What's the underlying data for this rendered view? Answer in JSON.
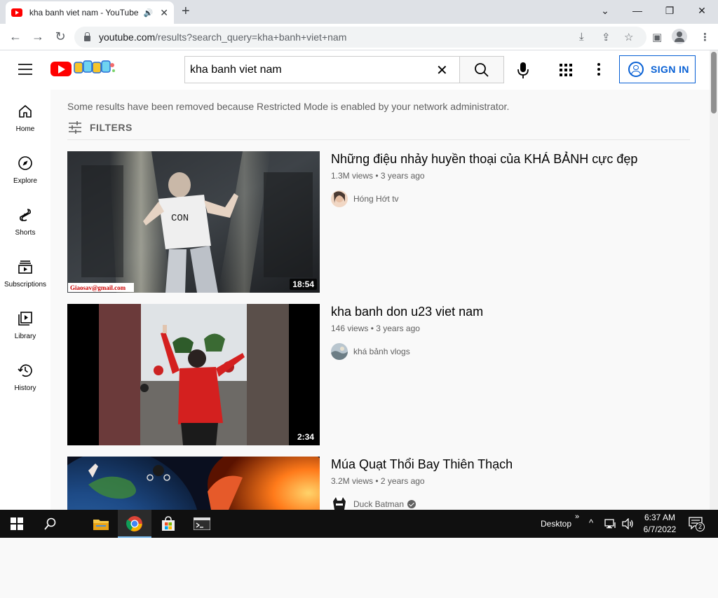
{
  "browser": {
    "tab_title": "kha banh viet nam - YouTube",
    "new_tab": "+",
    "url_host": "youtube.com",
    "url_path": "/results?search_query=kha+banh+viet+nam"
  },
  "header": {
    "search_value": "kha banh viet nam",
    "sign_in_label": "SIGN IN"
  },
  "guide": {
    "items": [
      {
        "label": "Home",
        "icon": "home-icon"
      },
      {
        "label": "Explore",
        "icon": "explore-icon"
      },
      {
        "label": "Shorts",
        "icon": "shorts-icon"
      },
      {
        "label": "Subscriptions",
        "icon": "subscriptions-icon"
      },
      {
        "label": "Library",
        "icon": "library-icon"
      },
      {
        "label": "History",
        "icon": "history-icon"
      }
    ]
  },
  "main": {
    "notice": "Some results have been removed because Restricted Mode is enabled by your network administrator.",
    "filters_label": "FILTERS",
    "results": [
      {
        "title": "Những điệu nhảy huyền thoại của KHÁ BẢNH cực đẹp",
        "meta": "1.3M views • 3 years ago",
        "channel": "Hóng Hớt tv",
        "duration": "18:54",
        "watermark": "Giaosav@gmail.com",
        "shirt_text": "CON"
      },
      {
        "title": "kha banh don u23 viet nam",
        "meta": "146 views • 3 years ago",
        "channel": "khá bảnh vlogs",
        "duration": "2:34"
      },
      {
        "title": "Múa Quạt Thổi Bay Thiên Thạch",
        "meta": "3.2M views • 2 years ago",
        "channel": "Duck Batman",
        "verified": true
      }
    ]
  },
  "taskbar": {
    "desktop_label": "Desktop",
    "time": "6:37 AM",
    "date": "6/7/2022",
    "notification_count": "2"
  },
  "colors": {
    "youtube_red": "#ff0000",
    "link_blue": "#065fd4",
    "taskbar": "#101010"
  }
}
